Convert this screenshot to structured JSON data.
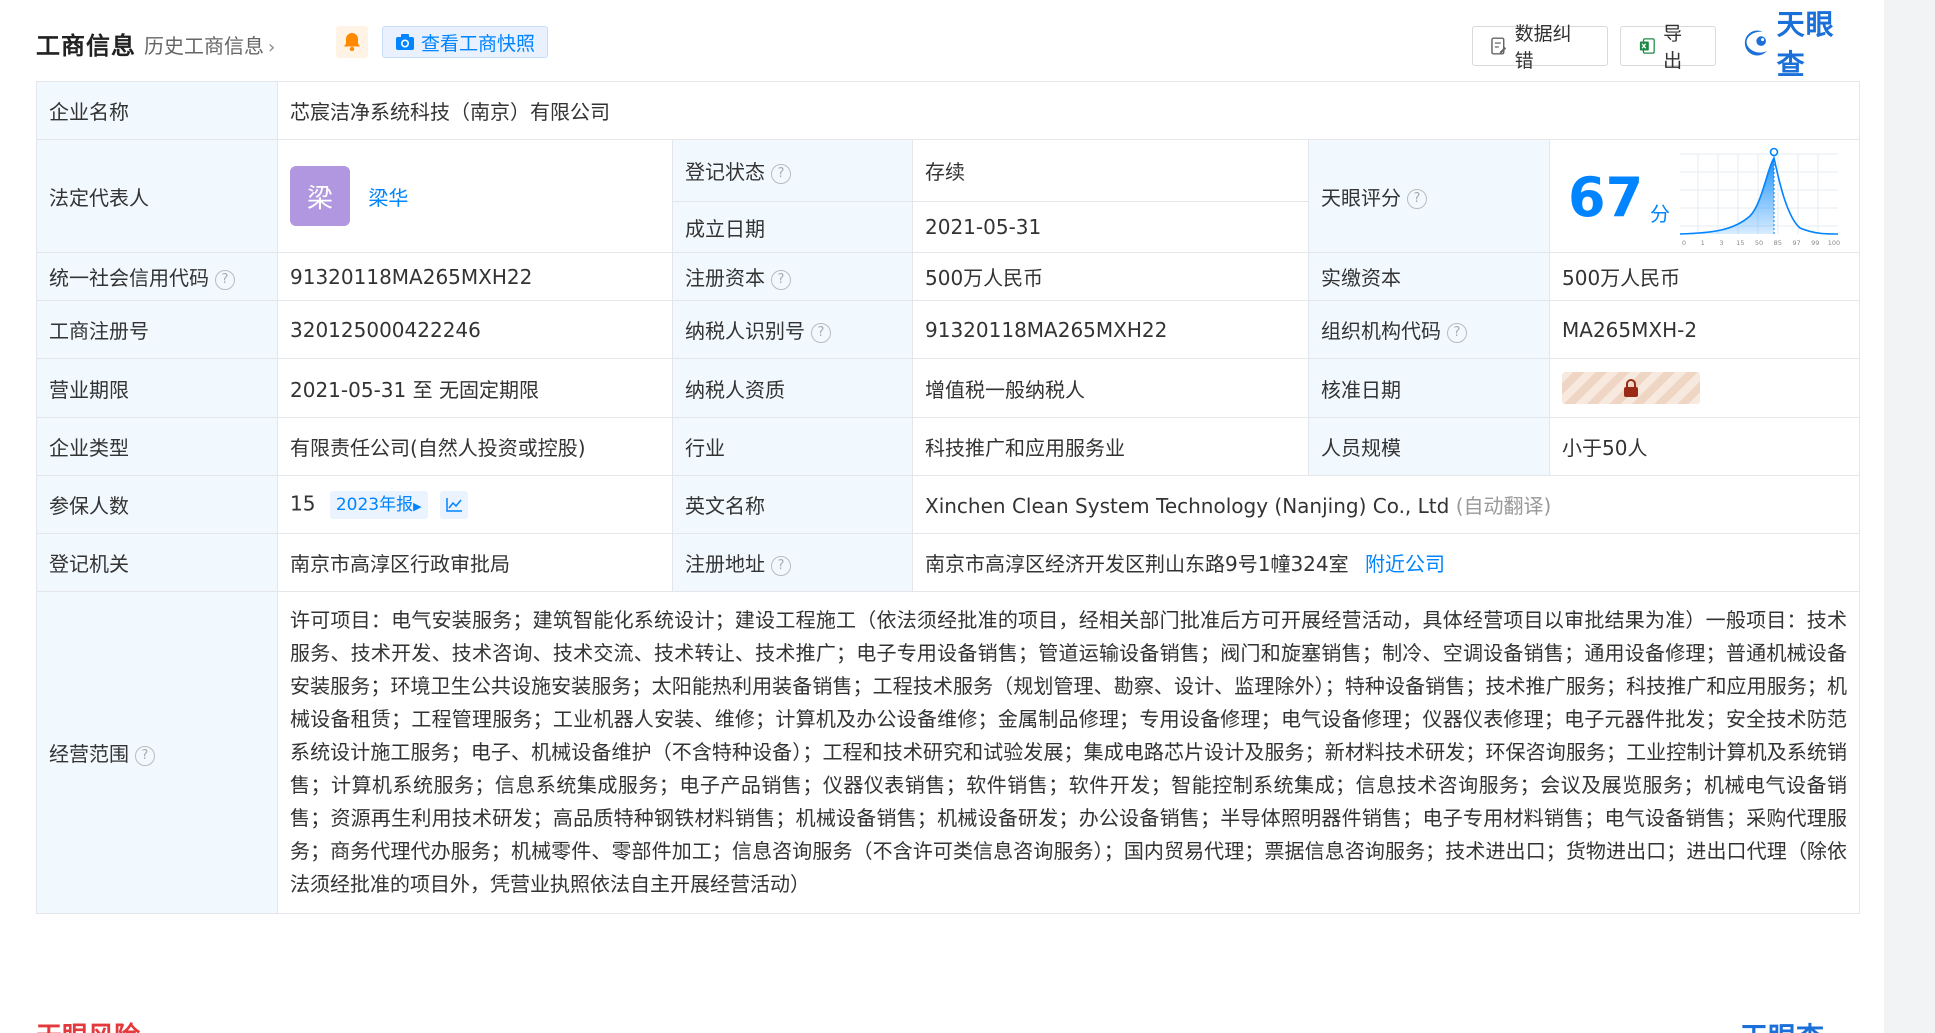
{
  "header": {
    "title": "工商信息",
    "history_link": "历史工商信息",
    "snapshot_button": "查看工商快照",
    "correct_button": "数据纠错",
    "export_button": "导出",
    "logo_text": "天眼查"
  },
  "rows": {
    "company_name_label": "企业名称",
    "company_name": "芯宸洁净系统科技（南京）有限公司",
    "legal_rep_label": "法定代表人",
    "legal_rep_avatar": "梁",
    "legal_rep_name": "梁华",
    "reg_status_label": "登记状态",
    "reg_status": "存续",
    "est_date_label": "成立日期",
    "est_date": "2021-05-31",
    "score_label": "天眼评分",
    "score_value": "67",
    "score_unit": "分",
    "credit_code_label": "统一社会信用代码",
    "credit_code": "91320118MA265MXH22",
    "reg_capital_label": "注册资本",
    "reg_capital": "500万人民币",
    "paid_capital_label": "实缴资本",
    "paid_capital": "500万人民币",
    "reg_no_label": "工商注册号",
    "reg_no": "320125000422246",
    "taxpayer_id_label": "纳税人识别号",
    "taxpayer_id": "91320118MA265MXH22",
    "org_code_label": "组织机构代码",
    "org_code": "MA265MXH-2",
    "term_label": "营业期限",
    "term": "2021-05-31 至 无固定期限",
    "taxpayer_qual_label": "纳税人资质",
    "taxpayer_qual": "增值税一般纳税人",
    "approve_date_label": "核准日期",
    "type_label": "企业类型",
    "type": "有限责任公司(自然人投资或控股)",
    "industry_label": "行业",
    "industry": "科技推广和应用服务业",
    "staff_label": "人员规模",
    "staff": "小于50人",
    "insured_label": "参保人数",
    "insured": "15",
    "insured_report": "2023年报",
    "english_label": "英文名称",
    "english_name": "Xinchen Clean System Technology (Nanjing) Co., Ltd",
    "english_note": "(自动翻译)",
    "authority_label": "登记机关",
    "authority": "南京市高淳区行政审批局",
    "address_label": "注册地址",
    "address": "南京市高淳区经济开发区荆山东路9号1幢324室",
    "nearby_link": "附近公司",
    "scope_label": "经营范围",
    "scope": "许可项目：电气安装服务；建筑智能化系统设计；建设工程施工（依法须经批准的项目，经相关部门批准后方可开展经营活动，具体经营项目以审批结果为准）一般项目：技术服务、技术开发、技术咨询、技术交流、技术转让、技术推广；电子专用设备销售；管道运输设备销售；阀门和旋塞销售；制冷、空调设备销售；通用设备修理；普通机械设备安装服务；环境卫生公共设施安装服务；太阳能热利用装备销售；工程技术服务（规划管理、勘察、设计、监理除外）；特种设备销售；技术推广服务；科技推广和应用服务；机械设备租赁；工程管理服务；工业机器人安装、维修；计算机及办公设备维修；金属制品修理；专用设备修理；电气设备修理；仪器仪表修理；电子元器件批发；安全技术防范系统设计施工服务；电子、机械设备维护（不含特种设备）；工程和技术研究和试验发展；集成电路芯片设计及服务；新材料技术研发；环保咨询服务；工业控制计算机及系统销售；计算机系统服务；信息系统集成服务；电子产品销售；仪器仪表销售；软件销售；软件开发；智能控制系统集成；信息技术咨询服务；会议及展览服务；机械电气设备销售；资源再生利用技术研发；高品质特种钢铁材料销售；机械设备销售；机械设备研发；办公设备销售；半导体照明器件销售；电子专用材料销售；电气设备销售；采购代理服务；商务代理代办服务；机械零件、零部件加工；信息咨询服务（不含许可类信息咨询服务）；国内贸易代理；票据信息咨询服务；技术进出口；货物进出口；进出口代理（除依法须经批准的项目外，凭营业执照依法自主开展经营活动）"
  },
  "score_chart": {
    "ticks": [
      "0",
      "1",
      "3",
      "15",
      "50",
      "85",
      "97",
      "99",
      "100"
    ]
  },
  "footer": {
    "risk_title": "天眼风险",
    "logo_text": "天眼查"
  },
  "colors": {
    "accent": "#0084ff",
    "label_bg": "#f2f9fe",
    "status_green": "#0eab46",
    "avatar": "#b197e0"
  }
}
